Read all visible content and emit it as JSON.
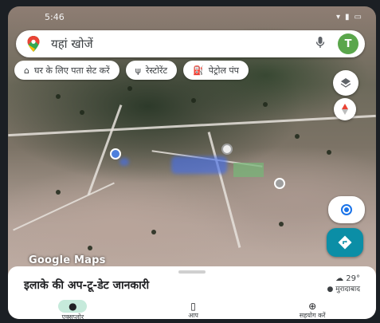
{
  "status_bar": {
    "time": "5:46"
  },
  "search": {
    "placeholder": "यहां खोजें",
    "avatar_letter": "T"
  },
  "chips": [
    {
      "icon": "home-icon",
      "label": "घर के लिए पता सेट करें"
    },
    {
      "icon": "restaurant-icon",
      "label": "रेस्टोरेंट"
    },
    {
      "icon": "gas-station-icon",
      "label": "पेट्रोल पंप"
    }
  ],
  "map": {
    "labels": [
      "",
      ""
    ],
    "attribution": "Google Maps"
  },
  "bottom_sheet": {
    "title": "इलाके की अप-टू-डेट जानकारी",
    "weather": {
      "temp": "29°",
      "location": "मुरादाबाद"
    }
  },
  "bottom_nav": [
    {
      "icon": "explore-icon",
      "label": "एक्सप्लोर",
      "active": true
    },
    {
      "icon": "saved-icon",
      "label": "आप",
      "active": false
    },
    {
      "icon": "contribute-icon",
      "label": "सहयोग करें",
      "active": false
    }
  ],
  "colors": {
    "directions_button": "#0b8ea6",
    "avatar": "#5aa64b",
    "active_nav_pill": "#c6eadb"
  }
}
